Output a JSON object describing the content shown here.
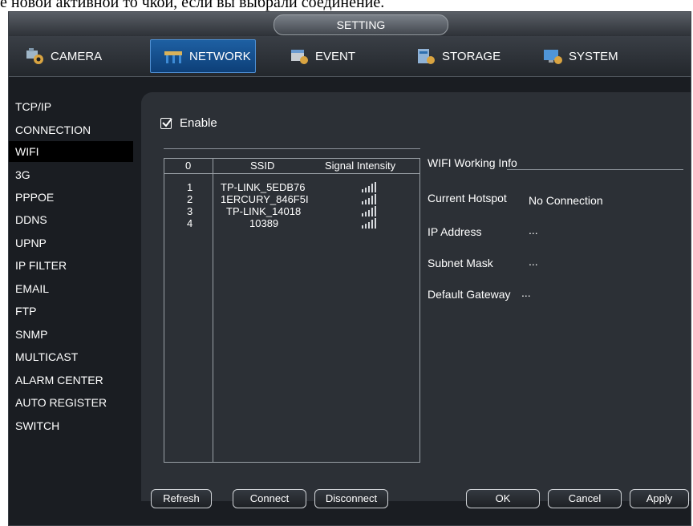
{
  "caption": "е новой активной то чкой, если вы выбрали соединение.",
  "window_title": "SETTING",
  "tabs": [
    {
      "label": "CAMERA",
      "icon": "camera-icon",
      "active": false
    },
    {
      "label": "NETWORK",
      "icon": "network-icon",
      "active": true
    },
    {
      "label": "EVENT",
      "icon": "event-icon",
      "active": false
    },
    {
      "label": "STORAGE",
      "icon": "storage-icon",
      "active": false
    },
    {
      "label": "SYSTEM",
      "icon": "system-icon",
      "active": false
    }
  ],
  "sidebar": {
    "items": [
      {
        "label": "TCP/IP"
      },
      {
        "label": "CONNECTION"
      },
      {
        "label": "WIFI"
      },
      {
        "label": "3G"
      },
      {
        "label": "PPPOE"
      },
      {
        "label": "DDNS"
      },
      {
        "label": "UPNP"
      },
      {
        "label": "IP FILTER"
      },
      {
        "label": "EMAIL"
      },
      {
        "label": "FTP"
      },
      {
        "label": "SNMP"
      },
      {
        "label": "MULTICAST"
      },
      {
        "label": "ALARM CENTER"
      },
      {
        "label": "AUTO REGISTER"
      },
      {
        "label": "SWITCH"
      }
    ],
    "active_index": 2
  },
  "enable": {
    "label": "Enable",
    "checked": true
  },
  "wifi_table": {
    "headers": {
      "index": "0",
      "ssid": "SSID",
      "signal": "Signal Intensity"
    },
    "rows": [
      {
        "index": "1",
        "ssid": "TP-LINK_5EDB76",
        "signal_level": 4
      },
      {
        "index": "2",
        "ssid": "1ERCURY_846F5I",
        "signal_level": 4
      },
      {
        "index": "3",
        "ssid": "TP-LINK_14018",
        "signal_level": 4
      },
      {
        "index": "4",
        "ssid": "10389",
        "signal_level": 4
      }
    ]
  },
  "working_info": {
    "title": "WIFI Working Info",
    "current_hotspot_label": "Current Hotspot",
    "current_hotspot_value": "No Connection",
    "ip_label": "IP Address",
    "ip_value": "...",
    "subnet_label": "Subnet Mask",
    "subnet_value": "...",
    "gateway_label": "Default Gateway",
    "gateway_value": "..."
  },
  "buttons": {
    "refresh": "Refresh",
    "connect": "Connect",
    "disconnect": "Disconnect",
    "ok": "OK",
    "cancel": "Cancel",
    "apply": "Apply"
  },
  "colors": {
    "background": "#1a1d22",
    "panel": "#2c3036",
    "active_tab": "#1e60a3",
    "signal_bars": "#d6d9dd"
  }
}
